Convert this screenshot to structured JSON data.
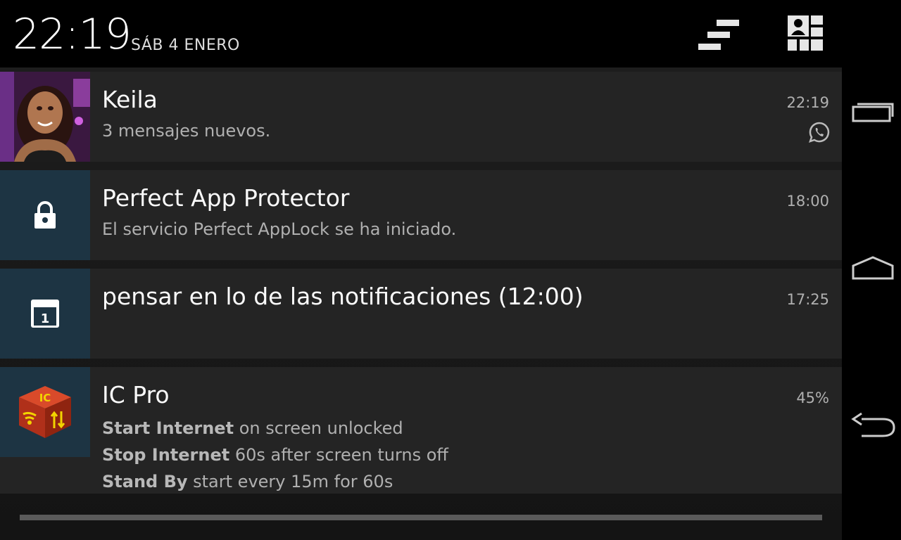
{
  "status_bar": {
    "time": "22:19",
    "date": "SÁB 4 ENERO",
    "quick_settings_icons": [
      "notification-list-icon",
      "quick-settings-icon"
    ]
  },
  "notifications": [
    {
      "title": "Keila",
      "text": "3 mensajes nuevos.",
      "time": "22:19",
      "icon": "contact-photo",
      "badge": "whatsapp-icon"
    },
    {
      "title": "Perfect App Protector",
      "text": "El servicio Perfect AppLock se ha iniciado.",
      "time": "18:00",
      "icon": "lock-icon"
    },
    {
      "title": "pensar en lo de las notificaciones (12:00)",
      "time": "17:25",
      "icon": "calendar-icon",
      "icon_label": "1"
    },
    {
      "title": "IC Pro",
      "time": "45%",
      "icon": "ic-pro-icon",
      "icon_label": "IC",
      "lines": [
        {
          "bold": "Start Internet",
          "rest": " on screen unlocked"
        },
        {
          "bold": "Stop Internet",
          "rest": " 60s after screen turns off"
        },
        {
          "bold": "Stand By",
          "rest": " start every 15m for 60s"
        }
      ]
    }
  ],
  "navigation": [
    "recent-apps-icon",
    "home-icon",
    "back-icon"
  ],
  "colors": {
    "icon_background": "#1d3443",
    "notification_background": "#242424",
    "ic_cube": "#c0391f",
    "ic_text": "#f2d400"
  }
}
